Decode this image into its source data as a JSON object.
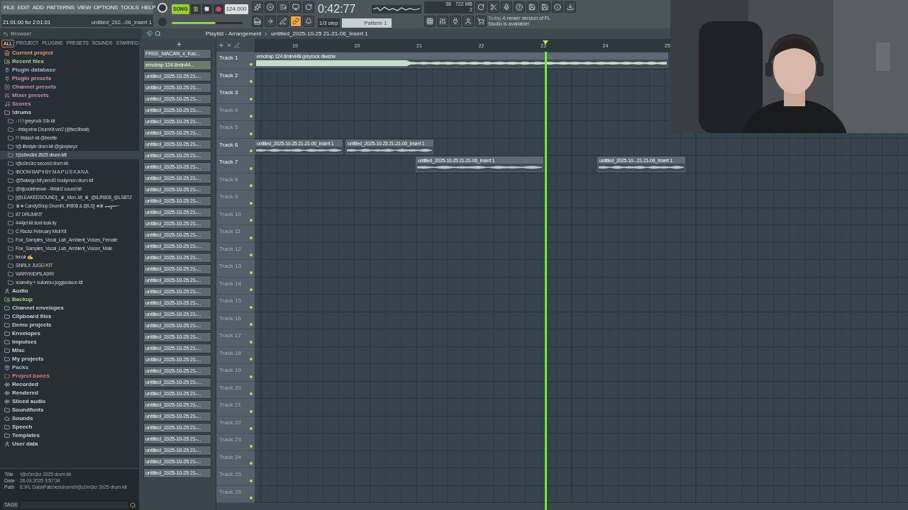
{
  "menu": [
    "FILE",
    "EDIT",
    "ADD",
    "PATTERNS",
    "VIEW",
    "OPTIONS",
    "TOOLS",
    "HELP"
  ],
  "hint": {
    "text": "21:01:00 for 2:01:01",
    "title": "untitled_202..-06_Insert 1"
  },
  "transport": {
    "mode": "SONG",
    "song_on": true,
    "tempo": "124.000",
    "time": "0:42:77"
  },
  "master_volume": {
    "level": 0.62
  },
  "monitor": {
    "cpu": "38",
    "memory": "722 MB",
    "polyphony": "2"
  },
  "tool_buttons": [
    {
      "kind": "keyboard",
      "on": false
    },
    {
      "kind": "arrow",
      "on": false
    },
    {
      "kind": "pen",
      "on": false
    },
    {
      "kind": "link",
      "on": true
    },
    {
      "kind": "bell",
      "on": false
    }
  ],
  "step": "1/3 step",
  "pattern": "Pattern 1",
  "news": {
    "tag": "Today",
    "text": "A newer version of FL Studio is available!"
  },
  "browser": {
    "title": "Browser",
    "tabs": [
      {
        "label": "ALL",
        "selected": true
      },
      {
        "label": "PROJECT",
        "selected": false
      },
      {
        "label": "PLUGINS",
        "selected": false
      },
      {
        "label": "PRESETS",
        "selected": false
      },
      {
        "label": "SOUNDS",
        "selected": false
      },
      {
        "label": "STARRED",
        "selected": false
      }
    ],
    "items": [
      {
        "label": "Current project",
        "kind": "project",
        "color": "#e0a070",
        "selected": false
      },
      {
        "label": "Recent files",
        "kind": "recent",
        "color": "#a9d07e",
        "selected": false
      },
      {
        "label": "Plugin database",
        "kind": "plugin",
        "color": "#9db4d6",
        "selected": false
      },
      {
        "label": "Plugin presets",
        "kind": "plugin",
        "color": "#d98aae",
        "selected": false
      },
      {
        "label": "Channel presets",
        "kind": "channel",
        "color": "#c38bb8",
        "selected": false
      },
      {
        "label": "Mixer presets",
        "kind": "mixer",
        "color": "#c38bb8",
        "selected": false
      },
      {
        "label": "Scores",
        "kind": "scores",
        "color": "#c38bb8",
        "selected": false
      },
      {
        "label": "!drums",
        "kind": "folder",
        "color": "#c8d0d4",
        "selected": false,
        "children": [
          {
            "label": "- ! ! ! greyrock 10k kit",
            "selected": false
          },
          {
            "label": "- #stepnine.DrumKit ver2 (@tec9beat)",
            "selected": false
          },
          {
            "label": "! ! !#stash kit @beetle",
            "selected": false
          },
          {
            "label": "!@ lifestyle drum kit @glorykeyz",
            "selected": false
          },
          {
            "label": "!@c0m3rz 2025 drum kit",
            "selected": true
          },
          {
            "label": "!@c0m3rz second drum kit",
            "selected": false
          },
          {
            "label": "!BOOM BAP II BY M A P U S K A N A",
            "selected": false
          },
          {
            "label": "@5wlargo tdf perc40 boolymon drum kit",
            "selected": false
          },
          {
            "label": "@djcodeinewar - #trlab2 sound kit",
            "selected": false
          },
          {
            "label": "[@LEAKEDSOUND] _♛_Mon..kit_♛_@ILIR808_@LS8TZ",
            "selected": false
          },
          {
            "label": "♛★ CandyShop DrumKi..IR808 & @LS] ★♛ ︻╦═─",
            "selected": false
          },
          {
            "label": "87 DRUMKIT",
            "selected": false
          },
          {
            "label": "444jet kit dont leak ily",
            "selected": false
          },
          {
            "label": "C Rackz February Midi Kit",
            "selected": false
          },
          {
            "label": "Fox_Samples_Vocal_Lab_Ambient_Voices_Female",
            "selected": false
          },
          {
            "label": "Fox_Samples_Vocal_Lab_Ambient_Voices_Male",
            "selected": false
          },
          {
            "label": "lenoir ✍",
            "selected": false
          },
          {
            "label": "SNRLX JUGG KIT",
            "selected": false
          },
          {
            "label": "WARYKIDPILA909",
            "selected": false
          },
          {
            "label": "xoarwby + sutoresu juggseason kit",
            "selected": false
          }
        ]
      },
      {
        "label": "Audio",
        "kind": "user",
        "color": "#c8d0d4",
        "selected": false
      },
      {
        "label": "Backup",
        "kind": "recent",
        "color": "#a9d07e",
        "selected": false
      },
      {
        "label": "Channel envelopes",
        "kind": "folder",
        "color": "#c8d0d4",
        "selected": false
      },
      {
        "label": "Clipboard files",
        "kind": "folder",
        "color": "#c8d0d4",
        "selected": false
      },
      {
        "label": "Demo projects",
        "kind": "folder",
        "color": "#c8d0d4",
        "selected": false
      },
      {
        "label": "Envelopes",
        "kind": "folder",
        "color": "#c8d0d4",
        "selected": false
      },
      {
        "label": "Impulses",
        "kind": "folder",
        "color": "#c8d0d4",
        "selected": false
      },
      {
        "label": "Misc",
        "kind": "folder",
        "color": "#c8d0d4",
        "selected": false
      },
      {
        "label": "My projects",
        "kind": "folder",
        "color": "#c8d0d4",
        "selected": false
      },
      {
        "label": "Packs",
        "kind": "pack",
        "color": "#9db4d6",
        "selected": false
      },
      {
        "label": "Project bones",
        "kind": "folder",
        "color": "#e07a7a",
        "selected": false
      },
      {
        "label": "Recorded",
        "kind": "wave",
        "color": "#c8d0d4",
        "selected": false
      },
      {
        "label": "Rendered",
        "kind": "wave",
        "color": "#c8d0d4",
        "selected": false
      },
      {
        "label": "Sliced audio",
        "kind": "wave",
        "color": "#c8d0d4",
        "selected": false
      },
      {
        "label": "Soundfonts",
        "kind": "folder",
        "color": "#c8d0d4",
        "selected": false
      },
      {
        "label": "Sounds",
        "kind": "cloud",
        "color": "#c8d0d4",
        "selected": false
      },
      {
        "label": "Speech",
        "kind": "folder",
        "color": "#c8d0d4",
        "selected": false
      },
      {
        "label": "Templates",
        "kind": "folder",
        "color": "#c8d0d4",
        "selected": false
      },
      {
        "label": "User data",
        "kind": "user",
        "color": "#c8d0d4",
        "selected": false
      }
    ],
    "info": [
      {
        "label": "Title",
        "value": "!@c0m3rz 2025 drum kit"
      },
      {
        "label": "Date",
        "value": "26.03.2025 3:57:34"
      },
      {
        "label": "Path",
        "value": "E:\\FL Data\\Patches\\drums\\!@c0m3rz 2025 drum kit"
      }
    ],
    "tags": "TAGS"
  },
  "playlist": {
    "title": "Playlist - Arrangement",
    "pattern": "untitled_2025-10-25 21-21-06_Insert 1",
    "clip_list": [
      "FREE_MACAN_x_Kac...",
      "emotrap 124 8min44...",
      "untitled_2025-10-25 21-...",
      "untitled_2025-10-25 21-...",
      "untitled_2025-10-25 21-...",
      "untitled_2025-10-25 21-...",
      "untitled_2025-10-25 21-...",
      "untitled_2025-10-25 21-...",
      "untitled_2025-10-25 21-...",
      "untitled_2025-10-25 21-...",
      "untitled_2025-10-25 21-...",
      "untitled_2025-10-25 21-...",
      "untitled_2025-10-25 21-...",
      "untitled_2025-10-25 21-...",
      "untitled_2025-10-25 21-...",
      "untitled_2025-10-25 21-...",
      "untitled_2025-10-25 21-...",
      "untitled_2025-10-25 21-...",
      "untitled_2025-10-25 21-...",
      "untitled_2025-10-25 21-...",
      "untitled_2025-10-25 21-...",
      "untitled_2025-10-25 21-...",
      "untitled_2025-10-25 21-...",
      "untitled_2025-10-25 21-...",
      "untitled_2025-10-25 21-...",
      "untitled_2025-10-25 21-...",
      "untitled_2025-10-25 21-...",
      "untitled_2025-10-25 21-...",
      "untitled_2025-10-25 21-...",
      "untitled_2025-10-25 21-...",
      "untitled_2025-10-25 21-...",
      "untitled_2025-10-25 21-...",
      "untitled_2025-10-25 21-...",
      "untitled_2025-10-25 21-...",
      "untitled_2025-10-25 21-...",
      "untitled_2025-10-25 21-...",
      "untitled_2025-10-25 21-...",
      "untitled_2025-10-25 21-..."
    ],
    "bars": [
      "19",
      "20",
      "21",
      "22",
      "23",
      "24",
      "25"
    ],
    "tracks": [
      {
        "name": "Track 1",
        "active": true,
        "clips": [
          {
            "title": "emotrap 124 8min448 greyrock diwshix",
            "kind": "full"
          }
        ]
      },
      {
        "name": "Track 2",
        "active": true
      },
      {
        "name": "Track 3",
        "active": true
      },
      {
        "name": "Track 4",
        "active": false
      },
      {
        "name": "Track 5",
        "active": false
      },
      {
        "name": "Track 6",
        "active": true,
        "clips": [
          {
            "title": "untitled_2025-10-25 21-21-06_Insert 1",
            "kind": "thin"
          },
          {
            "title": "untitled_2025-10-25 21-21-06_Insert 1",
            "kind": "thin"
          }
        ]
      },
      {
        "name": "Track 7",
        "active": true,
        "clips": [
          {
            "title": "untitled_2025-10-25 21-21-06_Insert 1",
            "kind": "thin"
          },
          {
            "title": "untitled_2025-10-..21-21-06_Insert 1",
            "kind": "thin"
          }
        ]
      },
      {
        "name": "Track 8",
        "active": false
      },
      {
        "name": "Track 9",
        "active": false
      },
      {
        "name": "Track 10",
        "active": false
      },
      {
        "name": "Track 11",
        "active": false
      },
      {
        "name": "Track 12",
        "active": false
      },
      {
        "name": "Track 13",
        "active": false
      },
      {
        "name": "Track 14",
        "active": false
      },
      {
        "name": "Track 15",
        "active": false
      },
      {
        "name": "Track 16",
        "active": false
      },
      {
        "name": "Track 17",
        "active": false
      },
      {
        "name": "Track 18",
        "active": false
      },
      {
        "name": "Track 19",
        "active": false
      },
      {
        "name": "Track 20",
        "active": false
      },
      {
        "name": "Track 21",
        "active": false
      },
      {
        "name": "Track 22",
        "active": false
      },
      {
        "name": "Track 23",
        "active": false
      },
      {
        "name": "Track 24",
        "active": false
      },
      {
        "name": "Track 25",
        "active": false
      },
      {
        "name": "Track 26",
        "active": false
      }
    ]
  }
}
